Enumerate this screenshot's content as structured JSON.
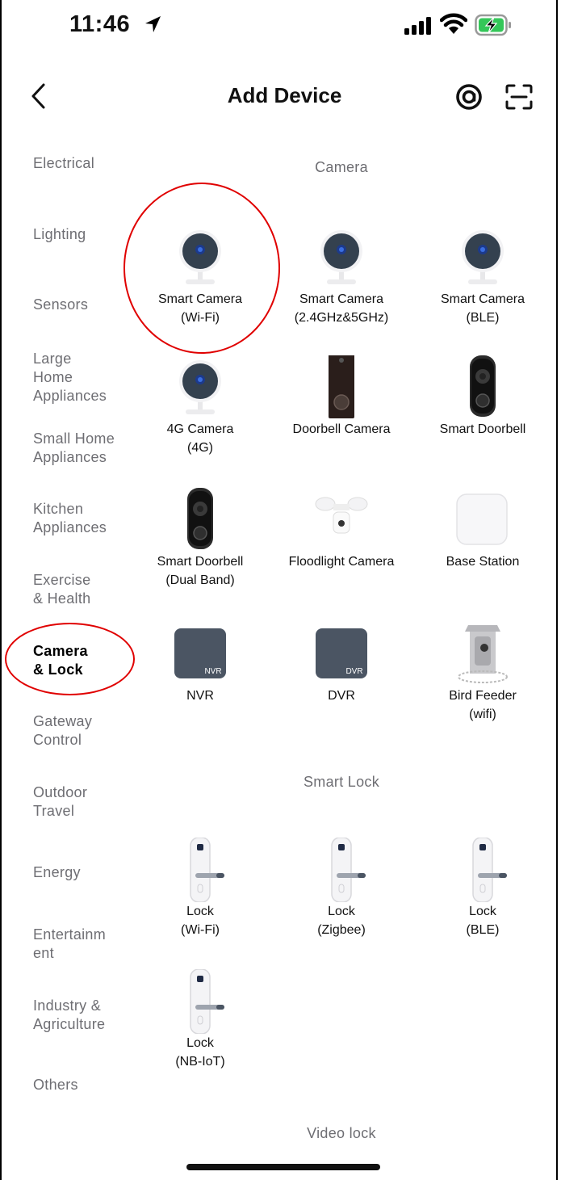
{
  "status": {
    "time": "11:46"
  },
  "header": {
    "title": "Add Device"
  },
  "sidebar": {
    "items": [
      {
        "label": "Electrical"
      },
      {
        "label": "Lighting"
      },
      {
        "label": "Sensors"
      },
      {
        "label": "Large\nHome\nAppliances"
      },
      {
        "label": "Small Home\nAppliances"
      },
      {
        "label": "Kitchen\nAppliances"
      },
      {
        "label": "Exercise\n& Health"
      },
      {
        "label": "Camera\n& Lock"
      },
      {
        "label": "Gateway\nControl"
      },
      {
        "label": "Outdoor\nTravel"
      },
      {
        "label": "Energy"
      },
      {
        "label": "Entertainm\nent"
      },
      {
        "label": "Industry &\nAgriculture"
      },
      {
        "label": "Others"
      }
    ]
  },
  "sections": {
    "camera": "Camera",
    "smart_lock": "Smart Lock",
    "video_lock": "Video lock"
  },
  "devices": {
    "camera": [
      {
        "label": "Smart Camera\n(Wi-Fi)",
        "icon": "camera-icon"
      },
      {
        "label": "Smart Camera\n(2.4GHz&5GHz)",
        "icon": "camera-icon"
      },
      {
        "label": "Smart Camera\n(BLE)",
        "icon": "camera-icon"
      },
      {
        "label": "4G Camera\n(4G)",
        "icon": "camera-icon"
      },
      {
        "label": "Doorbell Camera",
        "icon": "doorbell-tall-icon"
      },
      {
        "label": "Smart Doorbell",
        "icon": "doorbell-icon"
      },
      {
        "label": "Smart Doorbell\n(Dual Band)",
        "icon": "doorbell-icon"
      },
      {
        "label": "Floodlight Camera",
        "icon": "floodlight-icon"
      },
      {
        "label": "Base Station",
        "icon": "base-station-icon"
      },
      {
        "label": "NVR",
        "icon": "nvr-icon",
        "badge": "NVR"
      },
      {
        "label": "DVR",
        "icon": "dvr-icon",
        "badge": "DVR"
      },
      {
        "label": "Bird Feeder\n(wifi)",
        "icon": "bird-feeder-icon"
      }
    ],
    "lock": [
      {
        "label": "Lock\n(Wi-Fi)",
        "icon": "lock-icon"
      },
      {
        "label": "Lock\n(Zigbee)",
        "icon": "lock-icon"
      },
      {
        "label": "Lock\n(BLE)",
        "icon": "lock-icon"
      },
      {
        "label": "Lock\n(NB-IoT)",
        "icon": "lock-icon"
      }
    ]
  },
  "colors": {
    "annotation": "#e00000",
    "muted_text": "#6e6e73",
    "battery": "#34c759"
  }
}
